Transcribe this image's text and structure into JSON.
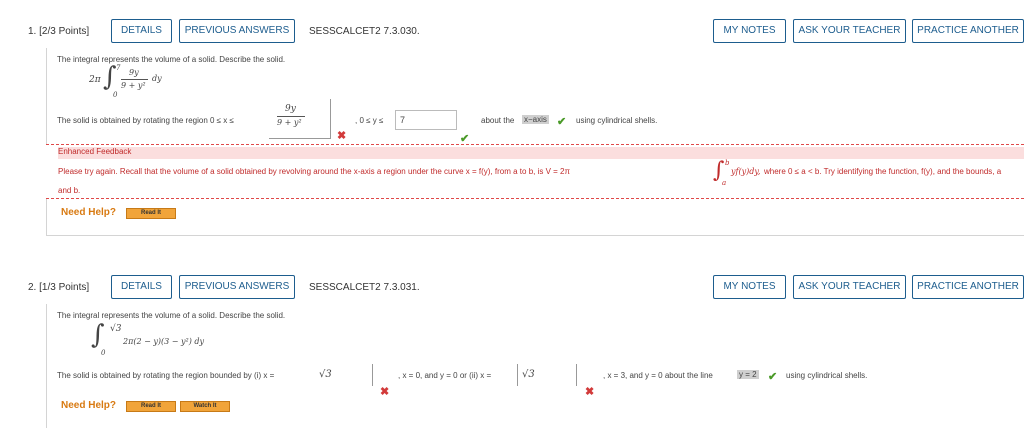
{
  "buttons": {
    "details": "DETAILS",
    "previous_answers": "PREVIOUS ANSWERS",
    "my_notes": "MY NOTES",
    "ask_teacher": "ASK YOUR TEACHER",
    "practice_another": "PRACTICE ANOTHER"
  },
  "q1": {
    "number": "1.  [2/3 Points]",
    "code": "SESSCALCET2 7.3.030.",
    "intro": "The integral represents the volume of a solid. Describe the solid.",
    "integral": {
      "coef": "2π",
      "upper": "7",
      "lower": "0",
      "num": "9y",
      "den": "9 + y²",
      "dvar": "dy"
    },
    "solid_prefix": "The solid is obtained by rotating the region  0 ≤ x ≤",
    "region_frac": {
      "num": "9y",
      "den": "9 + y²"
    },
    "mid_text": ", 0 ≤ y ≤",
    "y_upper_value": "7",
    "about_text": "about the",
    "axis_value": "x−axis",
    "tail_text": "using cylindrical shells.",
    "feedback_title": "Enhanced Feedback",
    "feedback_line1": "Please try again. Recall that the volume of a solid obtained by revolving around the x-axis a region under the curve  x = f(y),  from a to b, is  V = 2π",
    "feedback_integral": {
      "upper": "b",
      "lower": "a",
      "body": "yf(y)dy,"
    },
    "feedback_line1b": "where  0 ≤ a < b.  Try identifying the function,  f(y),  and the bounds, a",
    "feedback_line2": "and b.",
    "need_help": "Need Help?",
    "read_it": "Read It"
  },
  "q2": {
    "number": "2.  [1/3 Points]",
    "code": "SESSCALCET2 7.3.031.",
    "intro": "The integral represents the volume of a solid. Describe the solid.",
    "integral": {
      "upper": "√3",
      "lower": "0",
      "body": "2π(2 − y)(3 − y²) dy"
    },
    "solid_prefix": "The solid is obtained by rotating the region bounded by (i) x =",
    "ans1": "√3",
    "mid_text": ", x = 0, and y = 0 or (ii) x =",
    "ans2": "√3",
    "tail_text1": ", x = 3, and y = 0 about the line",
    "line_value": "y = 2",
    "tail_text2": "using cylindrical shells.",
    "need_help": "Need Help?",
    "read_it": "Read It",
    "watch_it": "Watch It"
  }
}
